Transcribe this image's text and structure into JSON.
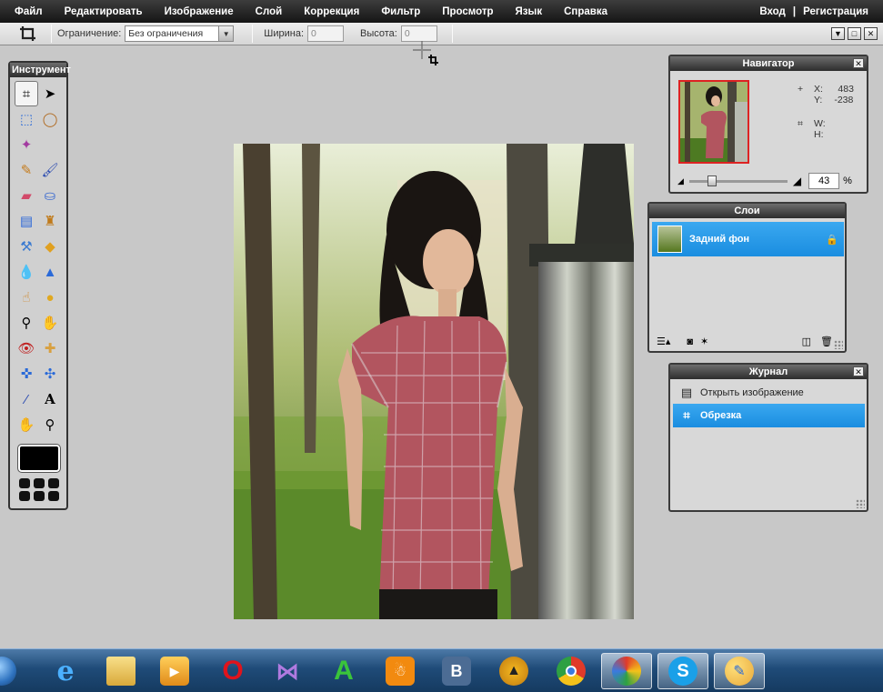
{
  "menu": {
    "items": [
      "Файл",
      "Редактировать",
      "Изображение",
      "Слой",
      "Коррекция",
      "Фильтр",
      "Просмотр",
      "Язык",
      "Справка"
    ],
    "login": "Вход",
    "separator": "|",
    "register": "Регистрация"
  },
  "options": {
    "constraint_label": "Ограничение:",
    "constraint_value": "Без ограничения",
    "width_label": "Ширина:",
    "width_value": "0",
    "height_label": "Высота:",
    "height_value": "0"
  },
  "toolbox": {
    "title": "Инструмент"
  },
  "navigator": {
    "title": "Навигатор",
    "x_label": "X:",
    "x_value": "483",
    "y_label": "Y:",
    "y_value": "-238",
    "w_label": "W:",
    "h_label": "H:",
    "zoom_value": "43",
    "zoom_unit": "%"
  },
  "layers": {
    "title": "Слои",
    "items": [
      {
        "label": "Задний фон",
        "locked": true
      }
    ]
  },
  "history": {
    "title": "Журнал",
    "items": [
      {
        "label": "Открыть изображение",
        "icon": "open-image-icon",
        "active": false
      },
      {
        "label": "Обрезка",
        "icon": "crop-icon",
        "active": true
      }
    ]
  },
  "colors": {
    "accent_blue": "#1a8de0",
    "menubar": "#151515",
    "workspace": "#c8c8c8",
    "primary_color": "#000000"
  },
  "taskbar": {
    "icons": [
      "start-orb-icon",
      "internet-explorer-icon",
      "explorer-folder-icon",
      "media-player-icon",
      "opera-icon",
      "visual-studio-icon",
      "a-app-icon",
      "odnoklassniki-icon",
      "vk-icon",
      "aimp-icon",
      "chrome-icon",
      "browser-orb-icon",
      "skype-icon",
      "paint-icon"
    ],
    "vk_label": "B"
  }
}
